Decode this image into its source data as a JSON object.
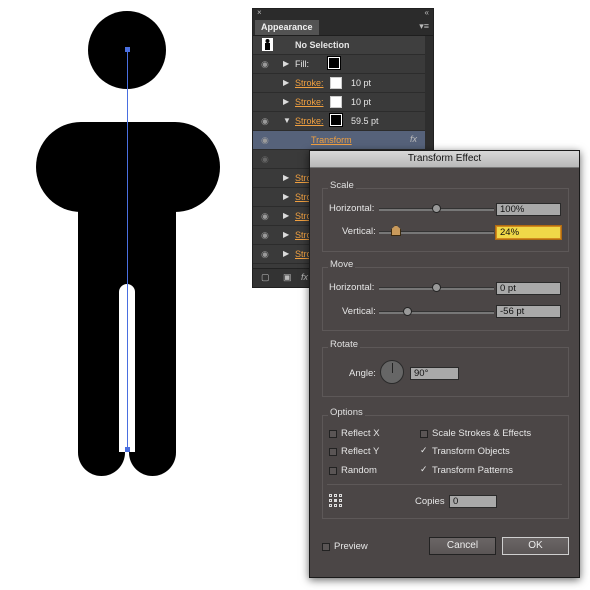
{
  "appearance_panel": {
    "close_glyph": "×",
    "collapse_glyph": "«",
    "tab_label": "Appearance",
    "menu_glyph": "▾≡",
    "header_label": "No Selection",
    "rows": [
      {
        "label": "Fill:",
        "value": ""
      },
      {
        "label": "Stroke:",
        "value": "10 pt"
      },
      {
        "label": "Stroke:",
        "value": "10 pt"
      },
      {
        "label": "Stroke:",
        "value": "59.5 pt"
      },
      {
        "label": "Transform",
        "value": "fx"
      },
      {
        "label": "",
        "value": ""
      },
      {
        "label": "Stro",
        "value": ""
      },
      {
        "label": "Stro",
        "value": ""
      },
      {
        "label": "Stro",
        "value": ""
      },
      {
        "label": "Stro",
        "value": ""
      },
      {
        "label": "Stro",
        "value": ""
      }
    ],
    "bottom_fx": "fx"
  },
  "dialog": {
    "title": "Transform Effect",
    "scale": {
      "title": "Scale",
      "horizontal_label": "Horizontal:",
      "horizontal_value": "100%",
      "vertical_label": "Vertical:",
      "vertical_value": "24%"
    },
    "move": {
      "title": "Move",
      "horizontal_label": "Horizontal:",
      "horizontal_value": "0 pt",
      "vertical_label": "Vertical:",
      "vertical_value": "-56 pt"
    },
    "rotate": {
      "title": "Rotate",
      "angle_label": "Angle:",
      "angle_value": "90°"
    },
    "options": {
      "title": "Options",
      "reflect_x": "Reflect X",
      "reflect_y": "Reflect Y",
      "random": "Random",
      "scale_strokes": "Scale Strokes & Effects",
      "transform_objects": "Transform Objects",
      "transform_patterns": "Transform Patterns",
      "copies_label": "Copies",
      "copies_value": "0"
    },
    "preview_label": "Preview",
    "cancel_label": "Cancel",
    "ok_label": "OK"
  },
  "colors": {
    "path_selection": "#4a6fe0",
    "active_field": "#f0d848",
    "stroke_link": "#f0a040"
  }
}
